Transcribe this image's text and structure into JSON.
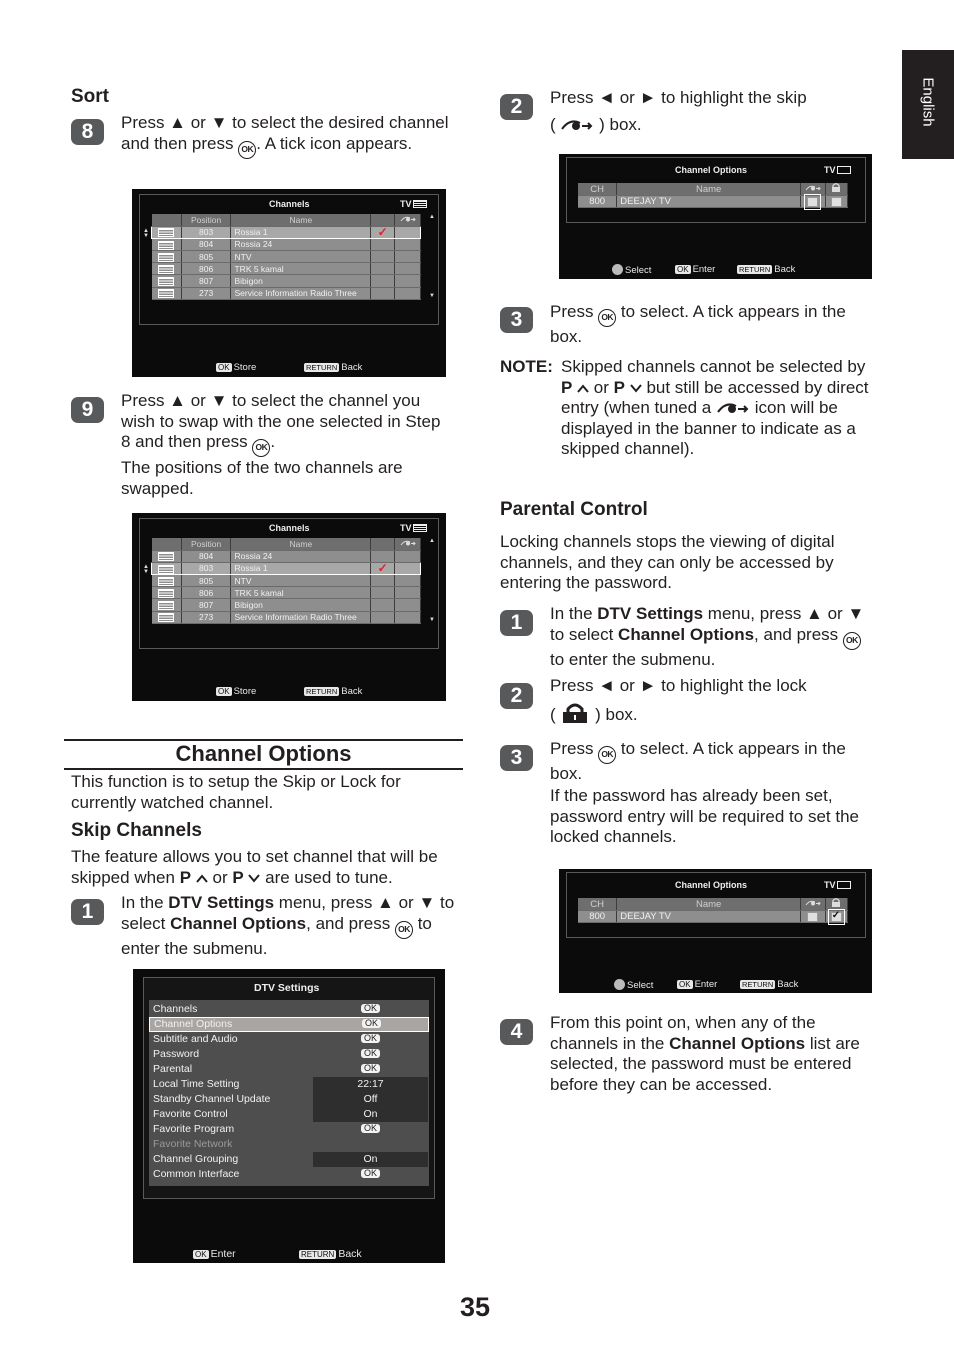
{
  "page": {
    "side_tab": "English",
    "page_number": "35"
  },
  "left": {
    "sort": {
      "heading": "Sort",
      "step8": {
        "badge": "8",
        "text_a": "Press ▲ or ▼ to select the desired channel and then press ",
        "ok": "OK",
        "text_b": ". A tick icon appears."
      },
      "step9": {
        "badge": "9",
        "text_a": "Press ▲ or ▼ to select the channel you wish to swap with the one selected in Step 8 and then press ",
        "ok": "OK",
        "text_b": ".",
        "note": "The positions of the two channels are swapped."
      }
    },
    "screen1": {
      "title": "Channels",
      "tv": "TV",
      "headers": [
        "",
        "Position",
        "Name",
        "",
        ""
      ],
      "rows": [
        {
          "pos": "803",
          "name": "Rossia 1",
          "tick": "✓",
          "selected": true
        },
        {
          "pos": "804",
          "name": "Rossia 24",
          "tick": "",
          "selected": false
        },
        {
          "pos": "805",
          "name": "NTV",
          "tick": "",
          "selected": false
        },
        {
          "pos": "806",
          "name": "TRK 5 kamal",
          "tick": "",
          "selected": false
        },
        {
          "pos": "807",
          "name": "Bibigon",
          "tick": "",
          "selected": false
        },
        {
          "pos": "273",
          "name": "Service Information Radio Three",
          "tick": "",
          "selected": false
        }
      ],
      "footer": {
        "ok_key": "OK",
        "ok_label": "Store",
        "return_key": "RETURN",
        "return_label": "Back"
      }
    },
    "screen2": {
      "title": "Channels",
      "tv": "TV",
      "headers": [
        "",
        "Position",
        "Name",
        "",
        ""
      ],
      "rows": [
        {
          "pos": "804",
          "name": "Rossia 24",
          "tick": "",
          "selected": false
        },
        {
          "pos": "803",
          "name": "Rossia 1",
          "tick": "✓",
          "selected": true
        },
        {
          "pos": "805",
          "name": "NTV",
          "tick": "",
          "selected": false
        },
        {
          "pos": "806",
          "name": "TRK 5 kamal",
          "tick": "",
          "selected": false
        },
        {
          "pos": "807",
          "name": "Bibigon",
          "tick": "",
          "selected": false
        },
        {
          "pos": "273",
          "name": "Service Information Radio Three",
          "tick": "",
          "selected": false
        }
      ],
      "footer": {
        "ok_key": "OK",
        "ok_label": "Store",
        "return_key": "RETURN",
        "return_label": "Back"
      }
    },
    "channel_options": {
      "heading": "Channel Options",
      "intro": "This function is to setup the Skip or Lock for currently watched channel.",
      "skip_heading": "Skip Channels",
      "skip_text_a": "The feature allows you to set channel that will be skipped when ",
      "p": "P",
      "or": " or ",
      "skip_text_b": " are used to tune.",
      "step1": {
        "badge": "1",
        "t1": "In the ",
        "b1": "DTV Settings",
        "t2": " menu, press ▲ or ▼ to select ",
        "b2": "Channel Options",
        "t3": ", and press ",
        "ok": "OK",
        "t4": " to enter the submenu."
      }
    },
    "dtv_screen": {
      "title": "DTV Settings",
      "items": [
        {
          "label": "Channels",
          "value": "OK",
          "type": "ok"
        },
        {
          "label": "Channel Options",
          "value": "OK",
          "type": "ok",
          "selected": true
        },
        {
          "label": "Subtitle and Audio",
          "value": "OK",
          "type": "ok"
        },
        {
          "label": "Password",
          "value": "OK",
          "type": "ok"
        },
        {
          "label": "Parental",
          "value": "OK",
          "type": "ok"
        },
        {
          "label": "Local Time Setting",
          "value": "22:17",
          "type": "text"
        },
        {
          "label": "Standby Channel Update",
          "value": "Off",
          "type": "text"
        },
        {
          "label": "Favorite Control",
          "value": "On",
          "type": "text"
        },
        {
          "label": "Favorite Program",
          "value": "OK",
          "type": "ok"
        },
        {
          "label": "Favorite Network",
          "value": "",
          "type": "disabled"
        },
        {
          "label": "Channel Grouping",
          "value": "On",
          "type": "text"
        },
        {
          "label": "Common Interface",
          "value": "OK",
          "type": "ok"
        }
      ],
      "footer": {
        "ok_key": "OK",
        "ok_label": "Enter",
        "return_key": "RETURN",
        "return_label": "Back"
      }
    }
  },
  "right": {
    "skip_step2": {
      "badge": "2",
      "text_a": "Press ◄ or ► to highlight the skip",
      "text_b_open": "( ",
      "text_b_close": " ) box."
    },
    "co_screen1": {
      "title": "Channel Options",
      "tv": "TV",
      "headers": [
        "CH",
        "Name"
      ],
      "row": {
        "ch": "800",
        "name": "DEEJAY TV",
        "skip_checked": false,
        "lock_checked": false,
        "highlight": "skip"
      },
      "footer": {
        "select_label": "Select",
        "ok_key": "OK",
        "ok_label": "Enter",
        "return_key": "RETURN",
        "return_label": "Back"
      }
    },
    "skip_step3": {
      "badge": "3",
      "text_a": "Press ",
      "ok": "OK",
      "text_b": " to select. A tick appears in the box."
    },
    "note": {
      "label": "NOTE:",
      "t1": "Skipped channels cannot be selected by ",
      "p": "P",
      "or": " or ",
      "t2": " but still be accessed by direct entry (when tuned a ",
      "t3": " icon will be displayed in the banner to indicate as a skipped channel)."
    },
    "parental": {
      "heading": "Parental Control",
      "intro": "Locking channels stops the viewing of digital channels, and they can only be accessed by entering the password.",
      "step1": {
        "badge": "1",
        "t1": "In the ",
        "b1": "DTV Settings",
        "t2": " menu, press ▲ or ▼ to select ",
        "b2": "Channel Options",
        "t3": ", and press ",
        "ok": "OK",
        "t4": " to enter the submenu."
      },
      "step2": {
        "badge": "2",
        "text_a": "Press ◄ or ► to highlight the lock",
        "text_b_open": "( ",
        "text_b_close": " ) box."
      },
      "step3": {
        "badge": "3",
        "text_a": "Press ",
        "ok": "OK",
        "text_b": " to select. A tick appears in the box.",
        "note": "If the password has already been set, password entry will be required to set the locked channels."
      },
      "step4": {
        "badge": "4",
        "t1": "From this point on, when any of the channels in the ",
        "b1": "Channel Options",
        "t2": " list are selected, the password must be entered before they can be accessed."
      }
    },
    "co_screen2": {
      "title": "Channel Options",
      "tv": "TV",
      "headers": [
        "CH",
        "Name"
      ],
      "row": {
        "ch": "800",
        "name": "DEEJAY TV",
        "skip_checked": false,
        "lock_checked": true,
        "highlight": "lock"
      },
      "footer": {
        "select_label": "Select",
        "ok_key": "OK",
        "ok_label": "Enter",
        "return_key": "RETURN",
        "return_label": "Back"
      }
    }
  }
}
